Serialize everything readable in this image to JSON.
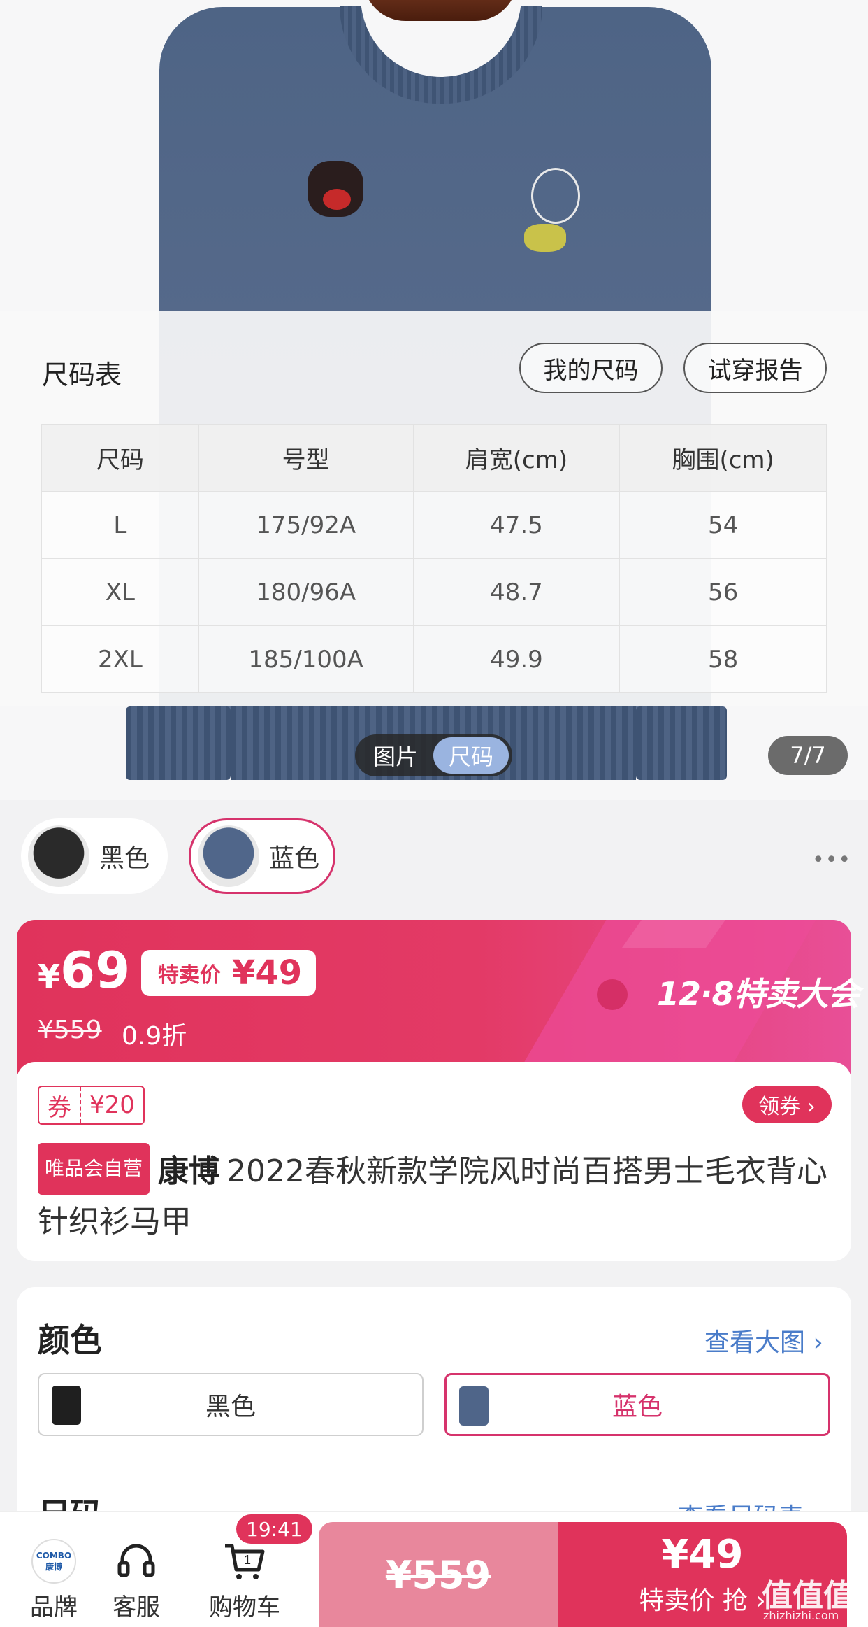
{
  "size_chart": {
    "title": "尺码表",
    "my_size_label": "我的尺码",
    "try_report_label": "试穿报告",
    "headers": [
      "尺码",
      "号型",
      "肩宽(cm)",
      "胸围(cm)"
    ],
    "rows": [
      [
        "L",
        "175/92A",
        "47.5",
        "54"
      ],
      [
        "XL",
        "180/96A",
        "48.7",
        "56"
      ],
      [
        "2XL",
        "185/100A",
        "49.9",
        "58"
      ]
    ]
  },
  "gallery": {
    "toggle_image": "图片",
    "toggle_size": "尺码",
    "page_counter": "7/7"
  },
  "color_chips": [
    {
      "label": "黑色",
      "selected": false
    },
    {
      "label": "蓝色",
      "selected": true
    }
  ],
  "more_icon": "•••",
  "price": {
    "yen": "¥",
    "current": "69",
    "special_label": "特卖价",
    "special_price": "¥49",
    "original": "¥559",
    "discount": "0.9折",
    "promo_title": "12·8特卖大会",
    "accent_color": "#e0335b"
  },
  "coupon": {
    "label": "券",
    "value": "¥20",
    "get_label": "领券 ›"
  },
  "product": {
    "vip_tag": "唯品会自营",
    "brand": "康博",
    "title": "2022春秋新款学院风时尚百搭男士毛衣背心针织衫马甲"
  },
  "color_section": {
    "heading": "颜色",
    "view_big": "查看大图 ›",
    "options": [
      {
        "label": "黑色",
        "selected": false
      },
      {
        "label": "蓝色",
        "selected": true
      }
    ]
  },
  "size_section": {
    "heading": "尺码",
    "link": "查看尺码表 ›"
  },
  "bottom_bar": {
    "brand_label": "品牌",
    "brand_logo_text": "COMBO康博",
    "service_label": "客服",
    "cart_label": "购物车",
    "cart_count": "1",
    "cart_badge_time": "19:41",
    "orig_price_btn": "¥559",
    "buy_price": "¥49",
    "buy_label": "特卖价 抢 ›"
  },
  "watermark": {
    "main": "值值值",
    "sub": "zhizhizhi.com"
  }
}
